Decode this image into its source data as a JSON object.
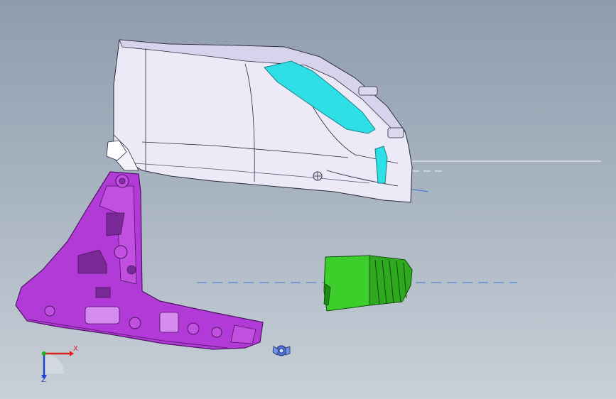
{
  "viewer": {
    "colors": {
      "background_top": "#8f9cad",
      "background_bottom": "#c8d0d8",
      "housing": "#eceaf6",
      "housing_shade": "#cfcbe6",
      "lens": "#2ee0e6",
      "bracket": "#b23ad6",
      "bracket_dark": "#6d1e86",
      "deflector": "#3ccf2c",
      "deflector_dark": "#1d8a14",
      "centerline": "#3a74c8"
    }
  },
  "scene": {
    "parts": [
      {
        "name": "lamp-housing",
        "color": "white"
      },
      {
        "name": "lamp-lens",
        "color": "cyan"
      },
      {
        "name": "mounting-bracket",
        "color": "purple"
      },
      {
        "name": "air-deflector",
        "color": "green"
      },
      {
        "name": "fastener-clip",
        "color": "blue"
      }
    ]
  },
  "triad": {
    "x_label": "X",
    "z_label": "Z",
    "x_color": "#e02020",
    "z_color": "#2040d0",
    "y_color": "#20b020"
  }
}
